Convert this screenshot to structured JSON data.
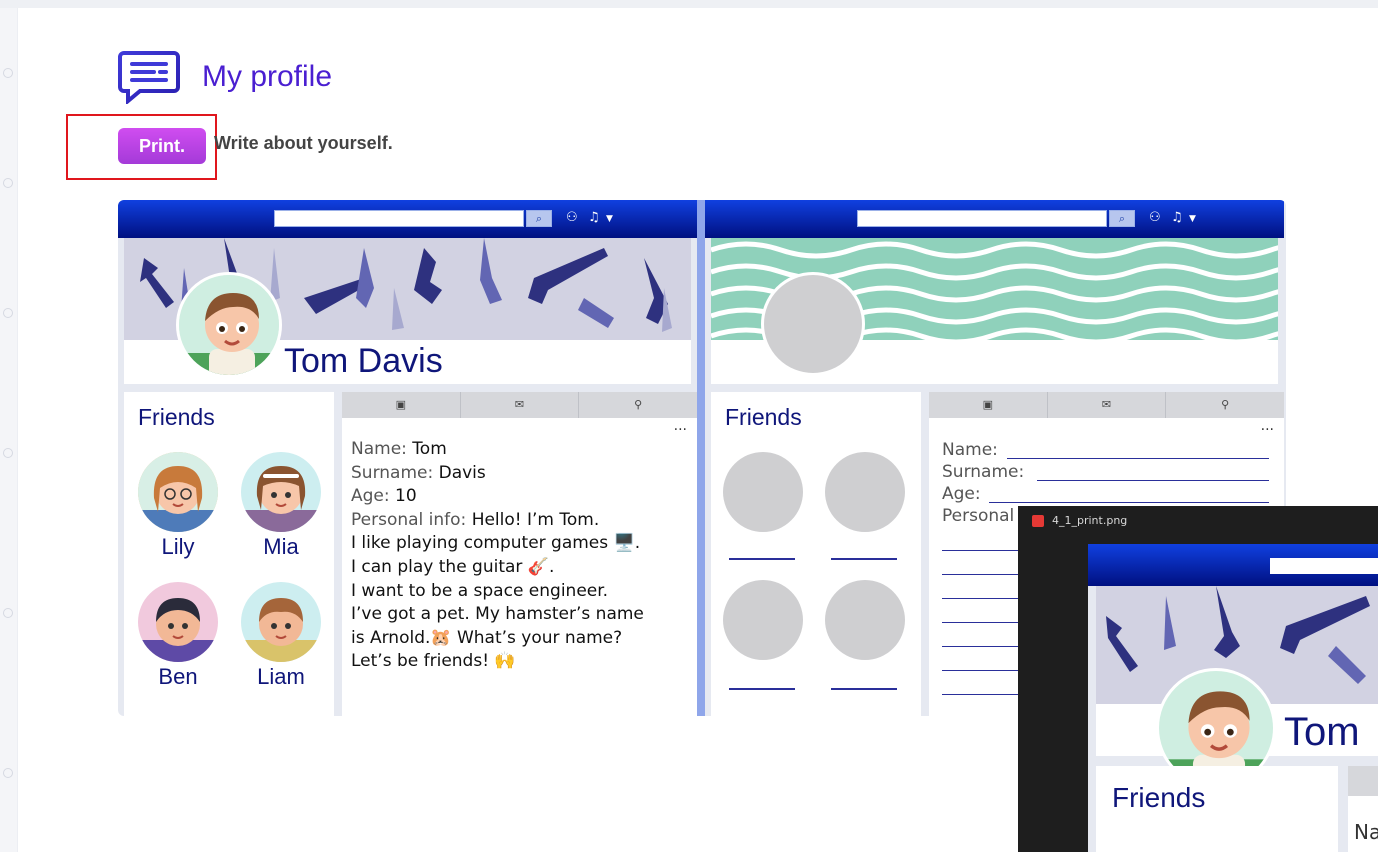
{
  "header": {
    "title": "My profile",
    "icon": "chat-message-icon"
  },
  "toolbar": {
    "print_label": "Print.",
    "instruction": "Write about yourself."
  },
  "worksheet": {
    "example": {
      "name": "Tom Davis",
      "friends_title": "Friends",
      "friends": [
        "Lily",
        "Mia",
        "Ben",
        "Liam"
      ],
      "tabs": [
        "video-icon",
        "message-icon",
        "location-icon"
      ],
      "more": "...",
      "info": {
        "name_label": "Name:",
        "name": "Tom",
        "surname_label": "Surname:",
        "surname": "Davis",
        "age_label": "Age:",
        "age": "10",
        "personal_label": "Personal info:",
        "lines": [
          "Hello! I’m Tom.",
          "I like playing computer games 🖥️.",
          "I can play the guitar 🎸.",
          "I want to be a space engineer.",
          "I’ve got a pet. My hamster’s name",
          "is Arnold.🐹 What’s your name?",
          "Let’s be friends! 🙌"
        ]
      }
    },
    "blank": {
      "friends_title": "Friends",
      "more": "...",
      "labels": {
        "name": "Name:",
        "surname": "Surname:",
        "age": "Age:",
        "personal": "Personal"
      }
    }
  },
  "popup": {
    "filename": "4_1_print.png",
    "preview_name": "Tom",
    "preview_friends": "Friends",
    "preview_info": "Na"
  },
  "colors": {
    "title": "#4a1fd1",
    "print_button": "#c447e8",
    "highlight": "#e0161d",
    "navy": "#0f167a"
  }
}
